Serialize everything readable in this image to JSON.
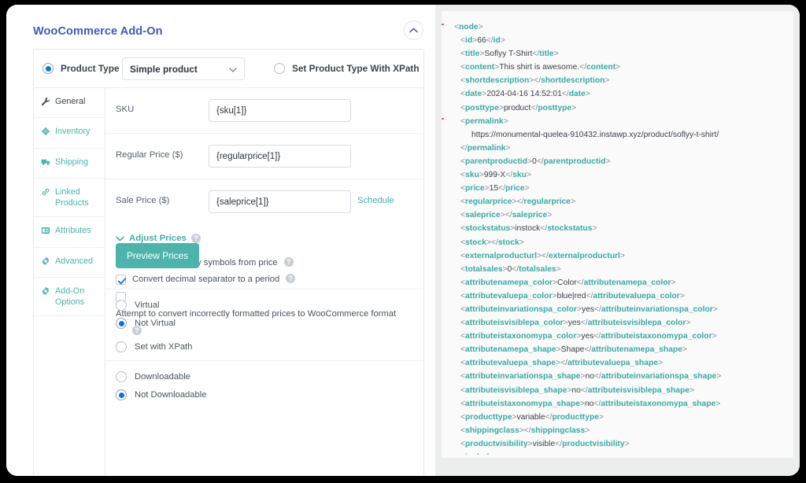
{
  "panel": {
    "title": "WooCommerce Add-On",
    "collapse_icon": "chevron-up-icon"
  },
  "product_type": {
    "radio_label": "Product Type",
    "selected_value": "Simple product",
    "dropdown_icon": "chevron-down-icon",
    "xpath_radio_label": "Set Product Type With XPath",
    "product_type_selected": true,
    "xpath_selected": false
  },
  "tabs": [
    {
      "label": "General",
      "icon": "wrench-icon",
      "active": true
    },
    {
      "label": "Inventory",
      "icon": "cube-icon",
      "active": false
    },
    {
      "label": "Shipping",
      "icon": "truck-icon",
      "active": false
    },
    {
      "label": "Linked Products",
      "icon": "link-icon",
      "active": false
    },
    {
      "label": "Attributes",
      "icon": "list-icon",
      "active": false
    },
    {
      "label": "Advanced",
      "icon": "gear-icon",
      "active": false
    },
    {
      "label": "Add-On Options",
      "icon": "gear-icon",
      "active": false
    }
  ],
  "fields": [
    {
      "label": "SKU",
      "value": "{sku[1]}"
    },
    {
      "label": "Regular Price ($)",
      "value": "{regularprice[1]}"
    },
    {
      "label": "Sale Price ($)",
      "value": "{saleprice[1]}"
    }
  ],
  "schedule_link": "Schedule",
  "adjust_prices": {
    "label": "Adjust Prices",
    "toggle_icon": "chevron-down-icon",
    "help_glyph": "?"
  },
  "checkboxes": [
    {
      "label": "Remove currency symbols from price",
      "checked": true,
      "help": true
    },
    {
      "label": "Convert decimal separator to a period",
      "checked": true,
      "help": true
    },
    {
      "label": "Attempt to convert incorrectly formatted prices to WooCommerce format",
      "checked": false,
      "help": true
    }
  ],
  "preview_button": "Preview Prices",
  "virtual_options": [
    {
      "label": "Virtual",
      "checked": false
    },
    {
      "label": "Not Virtual",
      "checked": true
    },
    {
      "label": "Set with XPath",
      "checked": false
    }
  ],
  "downloadable_options": [
    {
      "label": "Downloadable",
      "checked": false
    },
    {
      "label": "Not Downloadable",
      "checked": true
    }
  ],
  "xml": {
    "lines": [
      {
        "indent": 0,
        "collapse": true,
        "tag": "node"
      },
      {
        "indent": 1,
        "tag": "id",
        "text": "66",
        "closed": true
      },
      {
        "indent": 1,
        "tag": "title",
        "text": "Soflyy T-Shirt",
        "closed": true
      },
      {
        "indent": 1,
        "tag": "content",
        "text": "This shirt is awesome.",
        "closed": true
      },
      {
        "indent": 1,
        "tag": "shortdescription",
        "text": "",
        "closed": true
      },
      {
        "indent": 1,
        "tag": "date",
        "text": "2024-04-16 14:52:01",
        "closed": true
      },
      {
        "indent": 1,
        "tag": "posttype",
        "text": "product",
        "closed": true
      },
      {
        "indent": 1,
        "collapse": true,
        "tag": "permalink"
      },
      {
        "indent": 2,
        "raw": "https://monumental-quelea-910432.instawp.xyz/product/soflyy-t-shirt/"
      },
      {
        "indent": 1,
        "closetag": "permalink"
      },
      {
        "indent": 1,
        "tag": "parentproductid",
        "text": "0",
        "closed": true
      },
      {
        "indent": 1,
        "tag": "sku",
        "text": "999-X",
        "closed": true
      },
      {
        "indent": 1,
        "tag": "price",
        "text": "15",
        "closed": true
      },
      {
        "indent": 1,
        "tag": "regularprice",
        "text": "",
        "closed": true
      },
      {
        "indent": 1,
        "tag": "saleprice",
        "text": "",
        "closed": true
      },
      {
        "indent": 1,
        "tag": "stockstatus",
        "text": "instock",
        "closed": true
      },
      {
        "indent": 1,
        "tag": "stock",
        "text": "",
        "closed": true
      },
      {
        "indent": 1,
        "tag": "externalproducturl",
        "text": "",
        "closed": true
      },
      {
        "indent": 1,
        "tag": "totalsales",
        "text": "0",
        "closed": true
      },
      {
        "indent": 1,
        "tag": "attributenamepa_color",
        "text": "Color",
        "closed": true
      },
      {
        "indent": 1,
        "tag": "attributevaluepa_color",
        "text": "blue|red",
        "closed": true
      },
      {
        "indent": 1,
        "tag": "attributeinvariationspa_color",
        "text": "yes",
        "closed": true
      },
      {
        "indent": 1,
        "tag": "attributeisvisiblepa_color",
        "text": "yes",
        "closed": true
      },
      {
        "indent": 1,
        "tag": "attributeistaxonomypa_color",
        "text": "yes",
        "closed": true
      },
      {
        "indent": 1,
        "tag": "attributenamepa_shape",
        "text": "Shape",
        "closed": true
      },
      {
        "indent": 1,
        "tag": "attributevaluepa_shape",
        "text": "",
        "closed": true
      },
      {
        "indent": 1,
        "tag": "attributeinvariationspa_shape",
        "text": "no",
        "closed": true
      },
      {
        "indent": 1,
        "tag": "attributeisvisiblepa_shape",
        "text": "no",
        "closed": true
      },
      {
        "indent": 1,
        "tag": "attributeistaxonomypa_shape",
        "text": "no",
        "closed": true
      },
      {
        "indent": 1,
        "tag": "producttype",
        "text": "variable",
        "closed": true
      },
      {
        "indent": 1,
        "tag": "shippingclass",
        "text": "",
        "closed": true
      },
      {
        "indent": 1,
        "tag": "productvisibility",
        "text": "visible",
        "closed": true
      }
    ]
  },
  "colors": {
    "brand_blue": "#3b5bbf",
    "teal": "#4cb4ac",
    "tag_teal": "#3aa9a4",
    "collapse_red": "#e8635f",
    "radio_blue": "#0b74de"
  }
}
